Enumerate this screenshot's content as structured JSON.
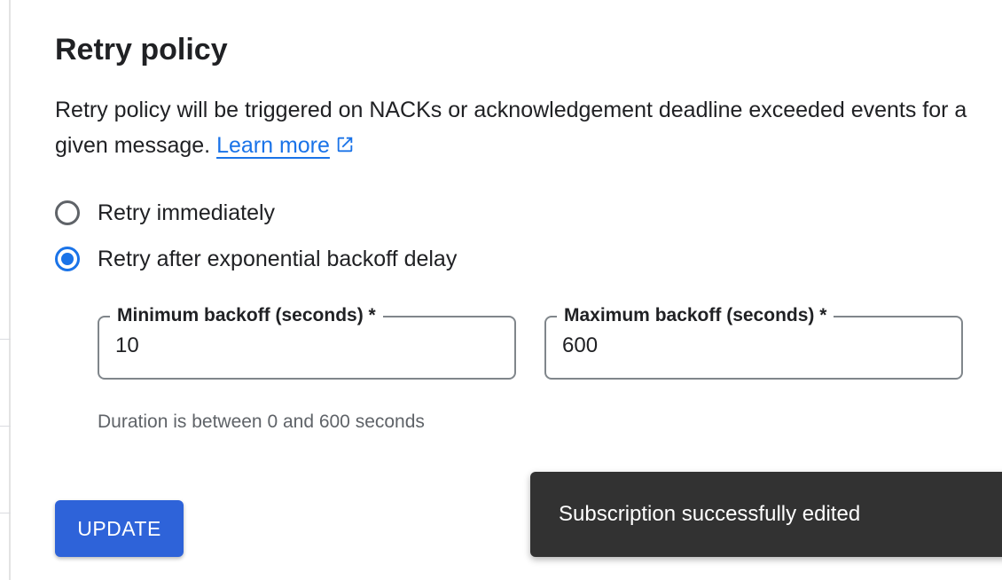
{
  "section": {
    "title": "Retry policy",
    "description": "Retry policy will be triggered on NACKs or acknowledgement deadline exceeded events for a given message.",
    "learn_more": "Learn more"
  },
  "options": [
    {
      "label": "Retry immediately",
      "selected": false
    },
    {
      "label": "Retry after exponential backoff delay",
      "selected": true
    }
  ],
  "fields": {
    "min_backoff": {
      "label": "Minimum backoff (seconds) *",
      "value": "10"
    },
    "max_backoff": {
      "label": "Maximum backoff (seconds) *",
      "value": "600"
    }
  },
  "hint": "Duration is between 0 and 600 seconds",
  "actions": {
    "update_label": "UPDATE"
  },
  "snackbar": {
    "message": "Subscription successfully edited"
  },
  "colors": {
    "accent": "#1a73e8",
    "button": "#2e63d9",
    "snackbar_bg": "#323232"
  },
  "icons": {
    "external_link": "open-in-new-icon"
  }
}
